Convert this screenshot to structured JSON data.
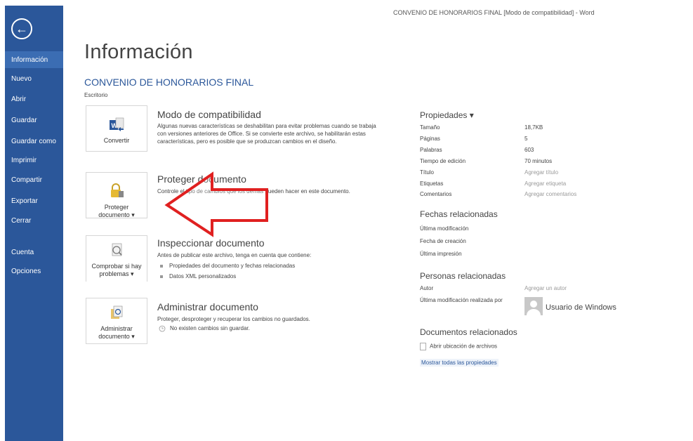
{
  "window_title": "CONVENIO DE HONORARIOS FINAL [Modo de compatibilidad] - Word",
  "sidebar": {
    "back_icon": "back-arrow-icon",
    "items": [
      {
        "label": "Información",
        "active": true
      },
      {
        "label": "Nuevo"
      },
      {
        "label": "Abrir"
      },
      {
        "label": "Guardar"
      },
      {
        "label": "Guardar como"
      },
      {
        "label": "Imprimir"
      },
      {
        "label": "Compartir"
      },
      {
        "label": "Exportar"
      },
      {
        "label": "Cerrar"
      },
      {
        "label": "Cuenta"
      },
      {
        "label": "Opciones"
      }
    ]
  },
  "main": {
    "heading": "Información",
    "doc_title": "CONVENIO DE HONORARIOS FINAL",
    "doc_location": "Escritorio",
    "sections": [
      {
        "tile_label_1": "Convertir",
        "tile_label_2": "",
        "title": "Modo de compatibilidad",
        "desc": "Algunas nuevas características se deshabilitan para evitar problemas cuando se trabaja con versiones anteriores de Office. Si se convierte este archivo, se habilitarán estas características, pero es posible que se produzcan cambios en el diseño."
      },
      {
        "tile_label_1": "Proteger",
        "tile_label_2": "documento ▾",
        "title": "Proteger documento",
        "desc": "Controle el tipo de cambios que los demás pueden hacer en este documento."
      },
      {
        "tile_label_1": "Comprobar si hay",
        "tile_label_2": "problemas ▾",
        "title": "Inspeccionar documento",
        "desc": "Antes de publicar este archivo, tenga en cuenta que contiene:",
        "bullets": [
          "Propiedades del documento y fechas relacionadas",
          "Datos XML personalizados"
        ]
      },
      {
        "tile_label_1": "Administrar",
        "tile_label_2": "documento ▾",
        "title": "Administrar documento",
        "desc": "Proteger, desproteger y recuperar los cambios no guardados.",
        "note": "No existen cambios sin guardar."
      }
    ]
  },
  "properties": {
    "heading": "Propiedades ▾",
    "rows": [
      {
        "label": "Tamaño",
        "value": "18,7KB"
      },
      {
        "label": "Páginas",
        "value": "5"
      },
      {
        "label": "Palabras",
        "value": "603"
      },
      {
        "label": "Tiempo de edición",
        "value": "70 minutos"
      },
      {
        "label": "Título",
        "value": "Agregar título"
      },
      {
        "label": "Etiquetas",
        "value": "Agregar etiqueta"
      },
      {
        "label": "Comentarios",
        "value": "Agregar comentarios"
      }
    ],
    "dates_heading": "Fechas relacionadas",
    "dates": [
      "Última modificación",
      "Fecha de creación",
      "Última impresión"
    ],
    "people_heading": "Personas relacionadas",
    "author_label": "Autor",
    "author_value": "Agregar un autor",
    "last_modified_by_label": "Última modificación realizada por",
    "last_modified_by_value": "Usuario de Windows",
    "docs_heading": "Documentos relacionados",
    "open_location": "Abrir ubicación de archivos",
    "show_all": "Mostrar todas las propiedades"
  },
  "colors": {
    "sidebar": "#2b579a",
    "accent": "#2b579a",
    "arrow": "#e02020"
  }
}
